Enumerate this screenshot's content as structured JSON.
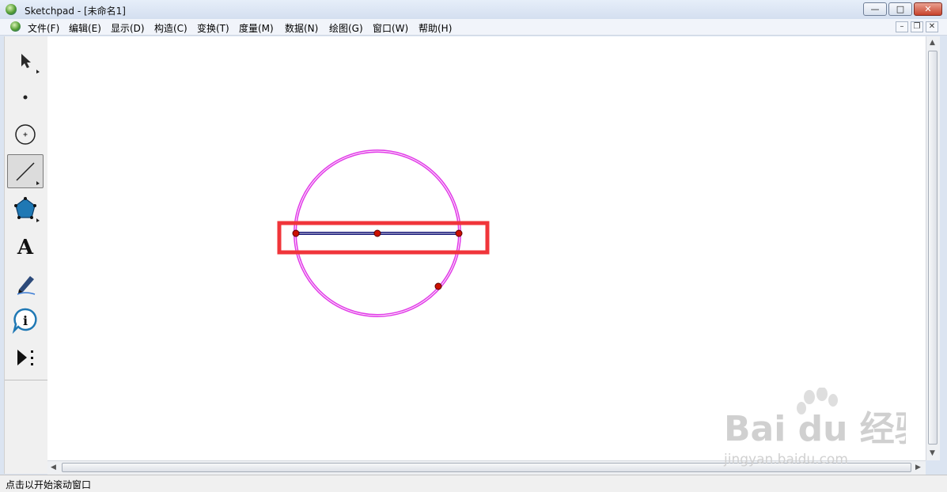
{
  "window": {
    "app_name": "Sketchpad",
    "title": "Sketchpad  - [未命名1]",
    "minimize": "—",
    "maximize": "□",
    "close": "✕"
  },
  "menu": [
    {
      "label": "文件(F)"
    },
    {
      "label": "编辑(E)"
    },
    {
      "label": "显示(D)"
    },
    {
      "label": "构造(C)"
    },
    {
      "label": "变换(T)"
    },
    {
      "label": "度量(M)"
    },
    {
      "label": "数据(N)"
    },
    {
      "label": "绘图(G)"
    },
    {
      "label": "窗口(W)"
    },
    {
      "label": "帮助(H)"
    }
  ],
  "doc_controls": {
    "minimize": "–",
    "restore": "❐",
    "close": "✕"
  },
  "toolbar": {
    "tools": [
      {
        "name": "selection-arrow-tool",
        "icon": "arrow-icon"
      },
      {
        "name": "point-tool",
        "icon": "point-icon"
      },
      {
        "name": "compass-tool",
        "icon": "circle-icon"
      },
      {
        "name": "straightedge-tool",
        "icon": "segment-icon",
        "active": true
      },
      {
        "name": "polygon-tool",
        "icon": "pentagon-icon"
      },
      {
        "name": "text-tool",
        "icon": "text-icon",
        "glyph": "A"
      },
      {
        "name": "marker-tool",
        "icon": "marker-pen-icon"
      },
      {
        "name": "information-tool",
        "icon": "info-icon",
        "glyph": "i"
      },
      {
        "name": "custom-tool",
        "icon": "custom-tools-icon"
      }
    ]
  },
  "colors": {
    "circle": "#e23be8",
    "segment": "#1a1a7a",
    "point": "#cc1100",
    "highlight_box": "#f0353a",
    "canvas": "#ffffff"
  },
  "watermark": {
    "brand": "Bai du 经验",
    "url": "jingyan.baidu.com"
  },
  "statusbar": {
    "text": "点击以开始滚动窗口"
  }
}
